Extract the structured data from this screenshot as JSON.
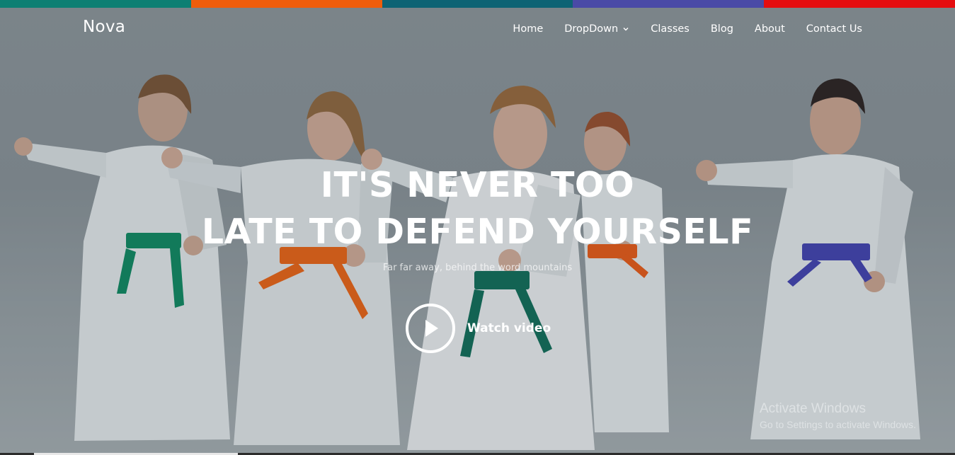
{
  "brand": "Nova",
  "colorbar": [
    "#0e7f73",
    "#ef5d0b",
    "#0e6374",
    "#4a4aa6",
    "#e50d10"
  ],
  "nav": {
    "items": [
      {
        "label": "Home"
      },
      {
        "label": "DropDown",
        "icon": "chevron-down-icon"
      },
      {
        "label": "Classes"
      },
      {
        "label": "Blog"
      },
      {
        "label": "About"
      },
      {
        "label": "Contact Us"
      }
    ]
  },
  "hero": {
    "title_line1": "IT'S NEVER TOO",
    "title_line2": "LATE TO DEFEND YOURSELF",
    "subtitle": "Far far away, behind the word mountains",
    "video_label": "Watch video",
    "video_icon": "play-icon",
    "image": "kids-karate-class-photo",
    "belt_colors": [
      "#0e8a62",
      "#ee6414",
      "#0f6e5a",
      "#ec5b16",
      "#4343b3"
    ]
  },
  "watermark": {
    "title": "Activate Windows",
    "subtitle": "Go to Settings to activate Windows."
  }
}
